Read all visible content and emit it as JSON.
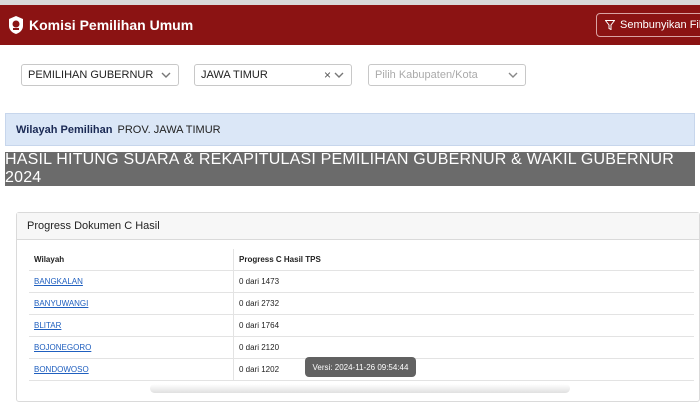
{
  "navbar": {
    "title": "Komisi Pemilihan Umum",
    "filter_button": "Sembunyikan Filter"
  },
  "filters": {
    "election_type": "PEMILIHAN GUBERNUR",
    "province": "JAWA TIMUR",
    "regency_placeholder": "Pilih Kabupaten/Kota"
  },
  "region": {
    "label": "Wilayah Pemilihan",
    "value": "PROV. JAWA TIMUR"
  },
  "page_title": "HASIL HITUNG SUARA & REKAPITULASI PEMILIHAN GUBERNUR & WAKIL GUBERNUR 2024",
  "progress": {
    "title": "Progress Dokumen C Hasil",
    "columns": [
      "Wilayah",
      "Progress C Hasil TPS"
    ],
    "rows": [
      {
        "region": "BANGKALAN",
        "progress": "0 dari 1473"
      },
      {
        "region": "BANYUWANGI",
        "progress": "0 dari 2732"
      },
      {
        "region": "BLITAR",
        "progress": "0 dari 1764"
      },
      {
        "region": "BOJONEGORO",
        "progress": "0 dari 2120"
      },
      {
        "region": "BONDOWOSO",
        "progress": "0 dari 1202"
      }
    ]
  },
  "tooltip": "Versi: 2024-11-26 09:54:44",
  "colors": {
    "navbar_bg": "#8b1313",
    "region_bg": "#dbe7f7",
    "title_bar_bg": "#6b6b6b",
    "link": "#1f5fbf"
  }
}
